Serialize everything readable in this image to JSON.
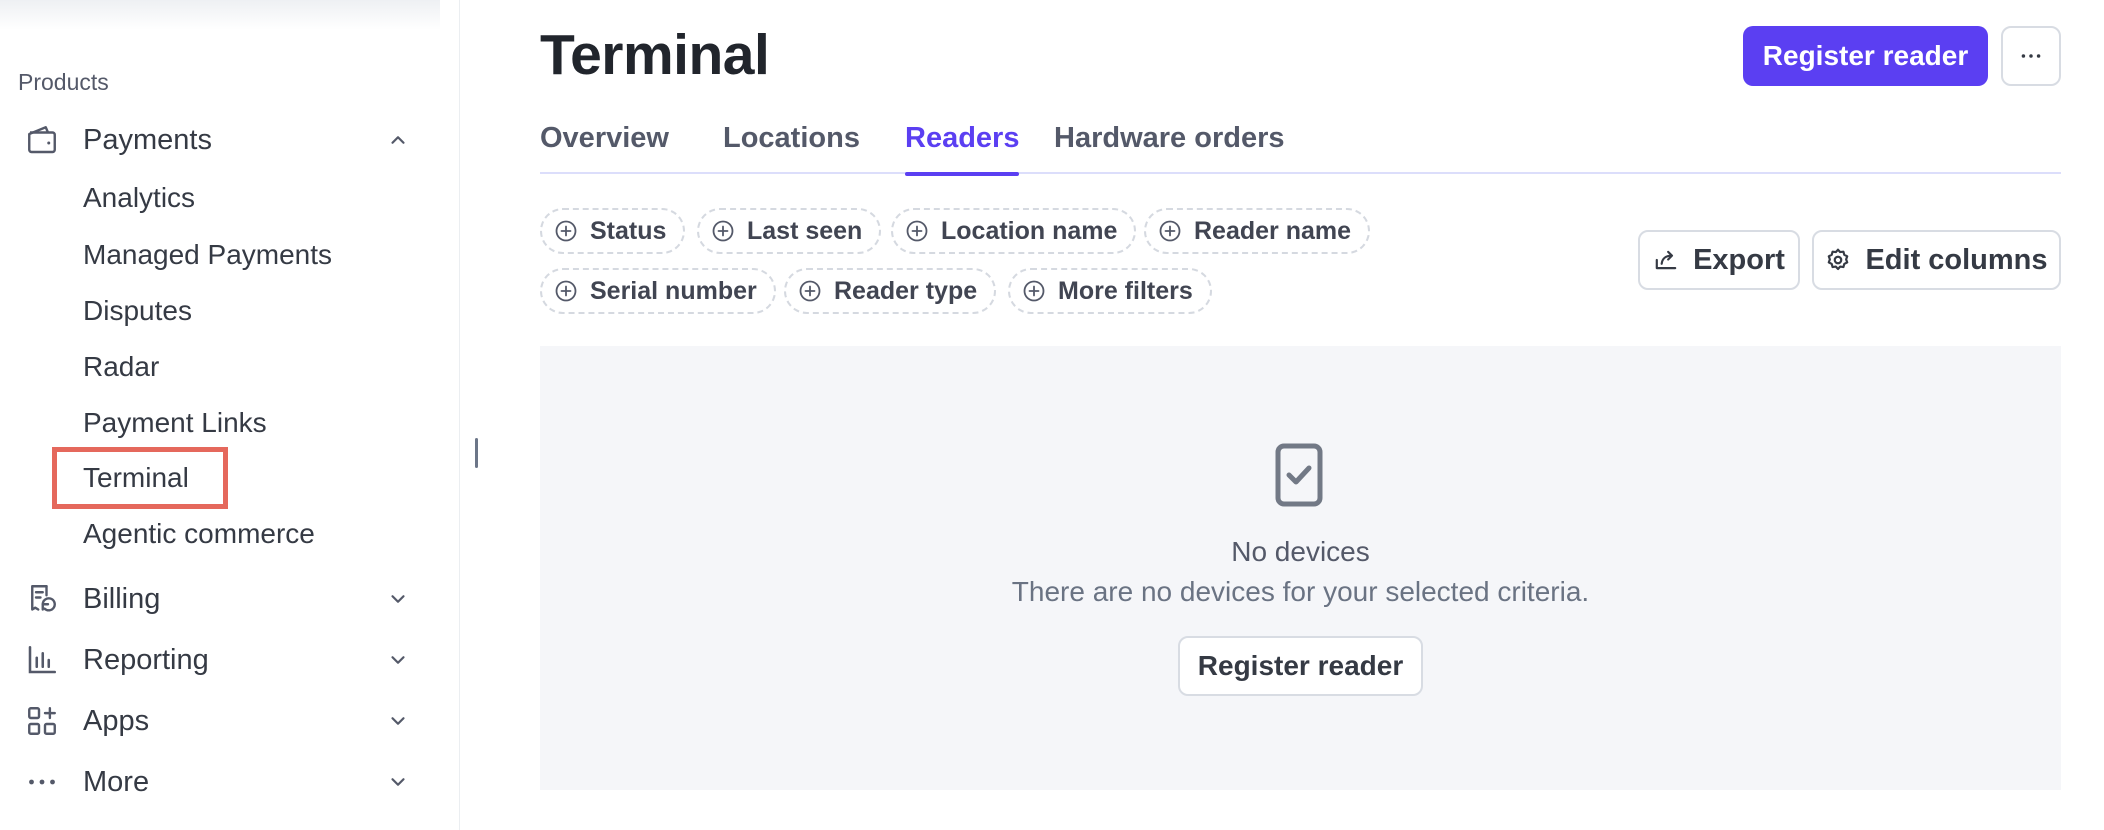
{
  "sidebar": {
    "section_label": "Products",
    "payments": {
      "label": "Payments",
      "icon": "wallet-icon",
      "expanded": true,
      "children": [
        "Analytics",
        "Managed Payments",
        "Disputes",
        "Radar",
        "Payment Links",
        "Terminal",
        "Agentic commerce"
      ],
      "selected": "Terminal"
    },
    "items": [
      {
        "label": "Billing",
        "icon": "billing-icon"
      },
      {
        "label": "Reporting",
        "icon": "bar-chart-icon"
      },
      {
        "label": "Apps",
        "icon": "apps-grid-icon"
      },
      {
        "label": "More",
        "icon": "ellipsis-icon"
      }
    ],
    "highlight_color": "#e5685c"
  },
  "header": {
    "title": "Terminal",
    "primary_button": "Register reader",
    "more_button_icon": "ellipsis-icon"
  },
  "tabs": [
    {
      "label": "Overview",
      "active": false
    },
    {
      "label": "Locations",
      "active": false
    },
    {
      "label": "Readers",
      "active": true
    },
    {
      "label": "Hardware orders",
      "active": false
    }
  ],
  "filters": [
    "Status",
    "Last seen",
    "Location name",
    "Reader name",
    "Serial number",
    "Reader type",
    "More filters"
  ],
  "actions": {
    "export": "Export",
    "edit_columns": "Edit columns"
  },
  "empty_state": {
    "icon": "reader-device-check-icon",
    "title": "No devices",
    "message": "There are no devices for your selected criteria.",
    "button": "Register reader"
  },
  "colors": {
    "accent": "#5b3ff2",
    "text": "#353a44",
    "muted": "#545969",
    "panel": "#f5f6f9"
  }
}
